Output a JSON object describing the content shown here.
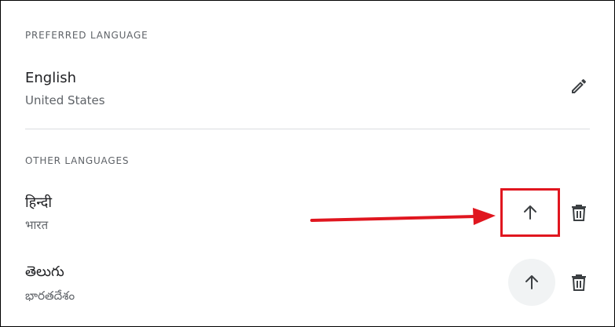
{
  "preferred": {
    "heading": "PREFERRED LANGUAGE",
    "language": {
      "name": "English",
      "region": "United States",
      "action_icon": "pencil-icon"
    }
  },
  "other": {
    "heading": "OTHER LANGUAGES",
    "languages": [
      {
        "name": "हिन्दी",
        "region": "भारत",
        "move_icon": "arrow-up-icon",
        "delete_icon": "trash-icon"
      },
      {
        "name": "తెలుగు",
        "region": "భారతదేశం",
        "move_icon": "arrow-up-icon",
        "delete_icon": "trash-icon"
      }
    ]
  },
  "annotation": {
    "color": "#e0161f"
  }
}
